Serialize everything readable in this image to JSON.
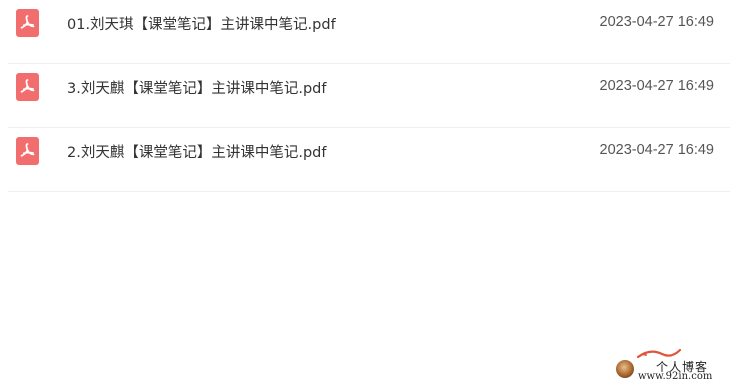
{
  "files": [
    {
      "name": "01.刘天琪【课堂笔记】主讲课中笔记.pdf",
      "date": "2023-04-27 16:49",
      "icon": "pdf-icon"
    },
    {
      "name": "3.刘天麒【课堂笔记】主讲课中笔记.pdf",
      "date": "2023-04-27 16:49",
      "icon": "pdf-icon"
    },
    {
      "name": "2.刘天麒【课堂笔记】主讲课中笔记.pdf",
      "date": "2023-04-27 16:49",
      "icon": "pdf-icon"
    }
  ],
  "watermark": {
    "title": "个人博客",
    "url": "www.92in.com"
  },
  "colors": {
    "pdf_icon": "#f26d6d",
    "text_primary": "#333333",
    "text_secondary": "#555555",
    "divider": "#f0f0f0"
  }
}
